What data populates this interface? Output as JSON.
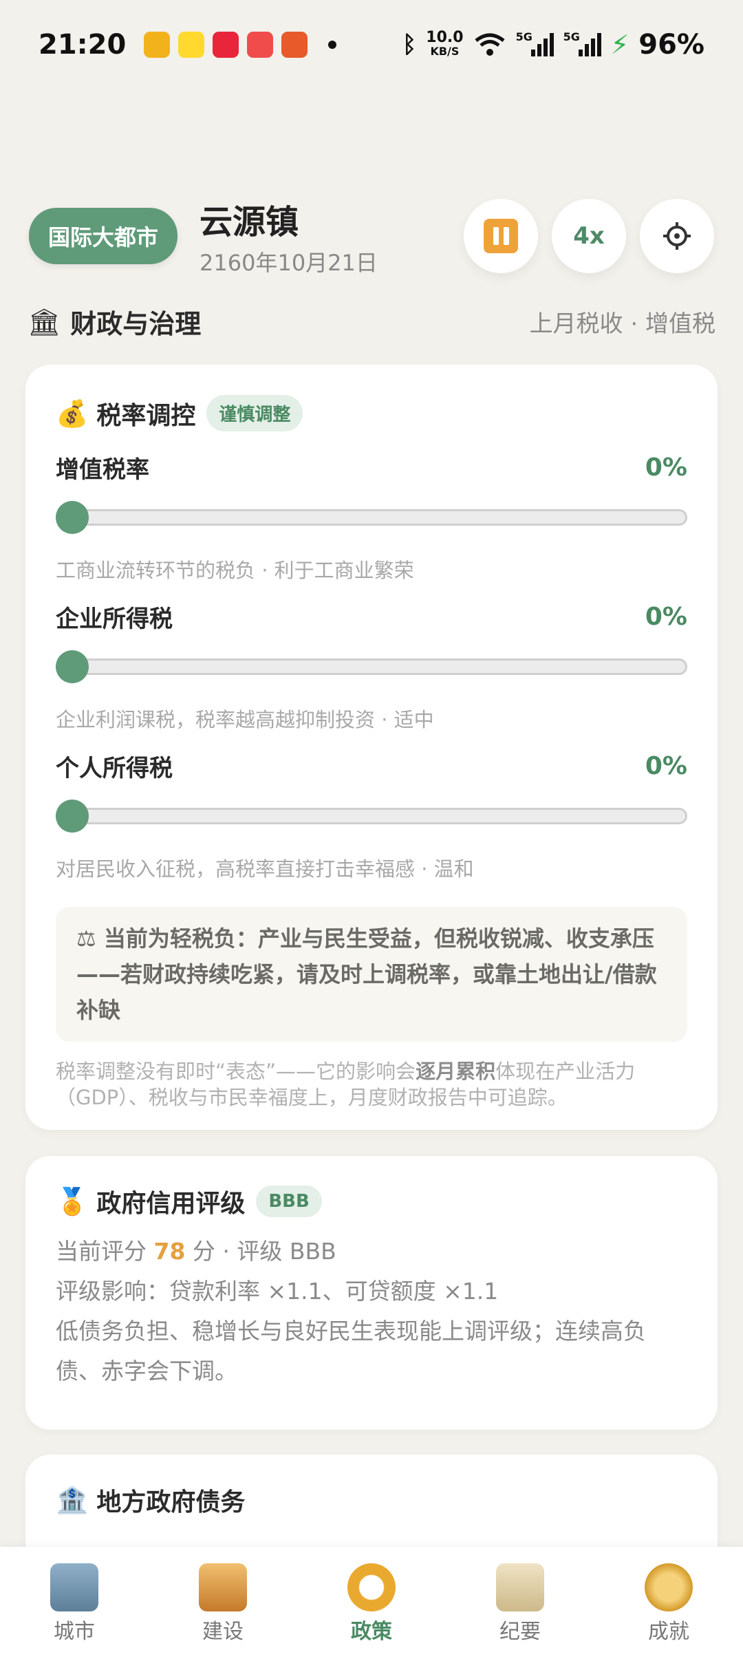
{
  "status": {
    "time": "21:20",
    "net_speed": "10.0",
    "net_unit": "KB/S",
    "battery": "96%"
  },
  "header": {
    "city_badge": "国际大都市",
    "town_name": "云源镇",
    "date": "2160年10月21日",
    "speed_label": "4x"
  },
  "finance": {
    "title": "财政与治理",
    "subtitle": "上月税收 · 增值税"
  },
  "tax_card": {
    "title": "税率调控",
    "tag": "谨慎调整",
    "rates": [
      {
        "name": "增值税率",
        "value": "0%",
        "level": 0,
        "desc": "工商业流转环节的税负 · 利于工商业繁荣"
      },
      {
        "name": "企业所得税",
        "value": "0%",
        "level": 0,
        "desc": "企业利润课税，税率越高越抑制投资 · 适中"
      },
      {
        "name": "个人所得税",
        "value": "0%",
        "level": 0,
        "desc": "对居民收入征税，高税率直接打击幸福感 · 温和"
      }
    ],
    "notice": "⚖ 当前为轻税负：产业与民生受益，但税收锐减、收支承压——若财政持续吃紧，请及时上调税率，或靠土地出让/借款补缺",
    "footnote_pre": "税率调整没有即时“表态”——它的影响会",
    "footnote_bold": "逐月累积",
    "footnote_post": "体现在产业活力（GDP）、税收与市民幸福度上，月度财政报告中可追踪。"
  },
  "credit_card": {
    "title": "政府信用评级",
    "grade_tag": "BBB",
    "score_pre": "当前评分 ",
    "score": "78",
    "score_post": " 分 · 评级 BBB",
    "impact": "评级影响：贷款利率 ×1.1、可贷额度 ×1.1",
    "note": "低债务负担、稳增长与良好民生表现能上调评级；连续高负债、赤字会下调。"
  },
  "debt_card": {
    "title": "地方政府债务"
  },
  "nav": [
    {
      "label": "城市",
      "active": false
    },
    {
      "label": "建设",
      "active": false
    },
    {
      "label": "政策",
      "active": true
    },
    {
      "label": "纪要",
      "active": false
    },
    {
      "label": "成就",
      "active": false
    }
  ]
}
